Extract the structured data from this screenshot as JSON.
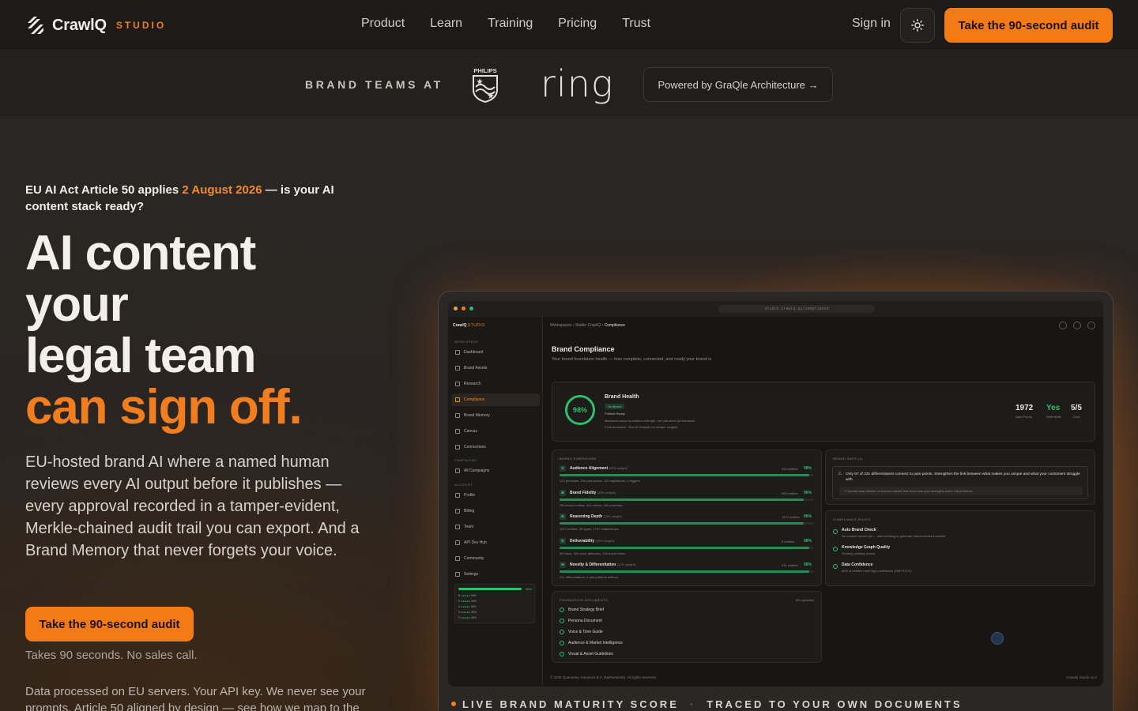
{
  "header": {
    "logo_text": "CrawlQ",
    "logo_sub": "STUDIO",
    "nav": [
      "Product",
      "Learn",
      "Training",
      "Pricing",
      "Trust"
    ],
    "signin": "Sign in",
    "cta": "Take the 90-second audit"
  },
  "brandstrip": {
    "label": "BRAND TEAMS AT",
    "logos": [
      "PHILIPS",
      "ring"
    ],
    "powered": "Powered by GraQle Architecture →"
  },
  "hero": {
    "eyebrow_a": "EU AI Act Article 50 applies ",
    "eyebrow_date": "2 August 2026",
    "eyebrow_b": " — is your AI content stack ready?",
    "headline_1": "AI content",
    "headline_2": "your",
    "headline_3": "legal team",
    "headline_4": "can sign off.",
    "subcopy": "EU-hosted brand AI where a named human reviews every AI output before it publishes — every approval recorded in a tamper-evident, Merkle-chained audit trail you can export. And a Brand Memory that never forgets your voice.",
    "cta": "Take the 90-second audit",
    "note": "Takes 90 seconds. No sales call.",
    "footnote": "Data processed on EU servers. Your API key. We never see your prompts. Article 50 aligned by design — see how we map to the"
  },
  "ticker": {
    "a": "LIVE BRAND MATURITY SCORE",
    "sep": "·",
    "b": "TRACED TO YOUR OWN DOCUMENTS"
  },
  "mock": {
    "url": "studio.crawlq.ai/compliance",
    "brand": "CrawlQ",
    "brand_sub": "STUDIO",
    "sections": {
      "workspace": "WORKSPACE",
      "campaigns": "CAMPAIGNS",
      "account": "ACCOUNT"
    },
    "nav": [
      "Dashboard",
      "Brand Assets",
      "Research",
      "Compliance",
      "Brand Memory",
      "Canvas",
      "Connections"
    ],
    "campaign_nav": [
      "All Campaigns"
    ],
    "account_nav": [
      "Profile",
      "Billing",
      "Team",
      "API Dev Hub",
      "Community",
      "Settings"
    ],
    "mini": {
      "total": "98%",
      "rows": [
        {
          "k": "B",
          "v": "98%"
        },
        {
          "k": "E",
          "v": "98%"
        },
        {
          "k": "A",
          "v": "98%"
        },
        {
          "k": "N",
          "v": "98%"
        },
        {
          "k": "D",
          "v": "98%"
        }
      ]
    },
    "crumb": [
      "Workspaces",
      "Studio CrawlQ",
      "Compliance"
    ],
    "title": "Brand Compliance",
    "subtitle": "Your brand foundation health — how complete, connected, and ready your brand is",
    "health": {
      "score": "98%",
      "title": "Brand Health",
      "badge": "On-Brand",
      "status": "Publish Ready",
      "desc1": "Measures brand foundation strength, not real-world performance.",
      "desc2": "Formula-based · Run AI Analysis for deeper insights",
      "stats": [
        {
          "num": "1972",
          "label": "Data Points"
        },
        {
          "num": "Yes",
          "label": "Defensible"
        },
        {
          "num": "5/5",
          "label": "Docs"
        }
      ]
    },
    "dimensions": {
      "heading": "BRAND DIMENSIONS",
      "items": [
        {
          "k": "A",
          "name": "Audience Alignment",
          "weight": "(25% weight)",
          "meta": "263 entities",
          "pct": "98%",
          "detail": "123 personas, 236 pain points, 129 aspirations, 4 triggers",
          "fill": 98
        },
        {
          "k": "B",
          "name": "Brand Fidelity",
          "weight": "(25% weight)",
          "meta": "265 entities",
          "pct": "96%",
          "detail": "265 brand entities, 240 values, 160 promises",
          "fill": 96
        },
        {
          "k": "R",
          "name": "Reasoning Depth",
          "weight": "(25% weight)",
          "meta": "1972 entities",
          "pct": "96%",
          "detail": "1972 entities, 38 types, 1797 relationships",
          "fill": 96
        },
        {
          "k": "D",
          "name": "Deliverability",
          "weight": "(15% weight)",
          "meta": "5 entities",
          "pct": "98%",
          "detail": "5/5 docs, 165 voice attributes, 106 brand terms",
          "fill": 98
        },
        {
          "k": "N",
          "name": "Novelty & Differentiation",
          "weight": "(10% weight)",
          "meta": "231 entities",
          "pct": "98%",
          "detail": "231 differentiators, 2 anti-patterns defined",
          "fill": 98
        }
      ]
    },
    "gaps": {
      "heading": "BRAND GAPS (1)",
      "text": "Only 67 of 231 differentiators connect to pain points. Strengthen the link between what makes you unique and what your customers struggle with.",
      "action": "Upload case studies or success stories that show how your strengths solve real problems."
    },
    "rules": {
      "heading": "COMPLIANCE RULES",
      "items": [
        {
          "name": "Auto Brand Check",
          "detail": "No content scored yet — start chatting to generate brand-checked content"
        },
        {
          "name": "Knowledge Graph Quality",
          "detail": "Turnkey pending review"
        },
        {
          "name": "Data Confidence",
          "detail": "86% of entities have high confidence (1697/1972)"
        }
      ]
    },
    "docs": {
      "heading": "FOUNDATION DOCUMENTS",
      "count": "5/5 uploaded",
      "items": [
        "Brand Strategy Brief",
        "Persona Document",
        "Voice & Tone Guide",
        "Audience & Market Intelligence",
        "Visual & Asset Guidelines"
      ]
    },
    "footer_copy": "© 2026 Quantamix Solutions B.V. (Netherlands). All rights reserved.",
    "footer_ver": "CrawlQ Studio v1.0"
  },
  "colors": {
    "accent": "#f47a16",
    "success": "#2fbf69",
    "bg": "#1b1a19"
  }
}
